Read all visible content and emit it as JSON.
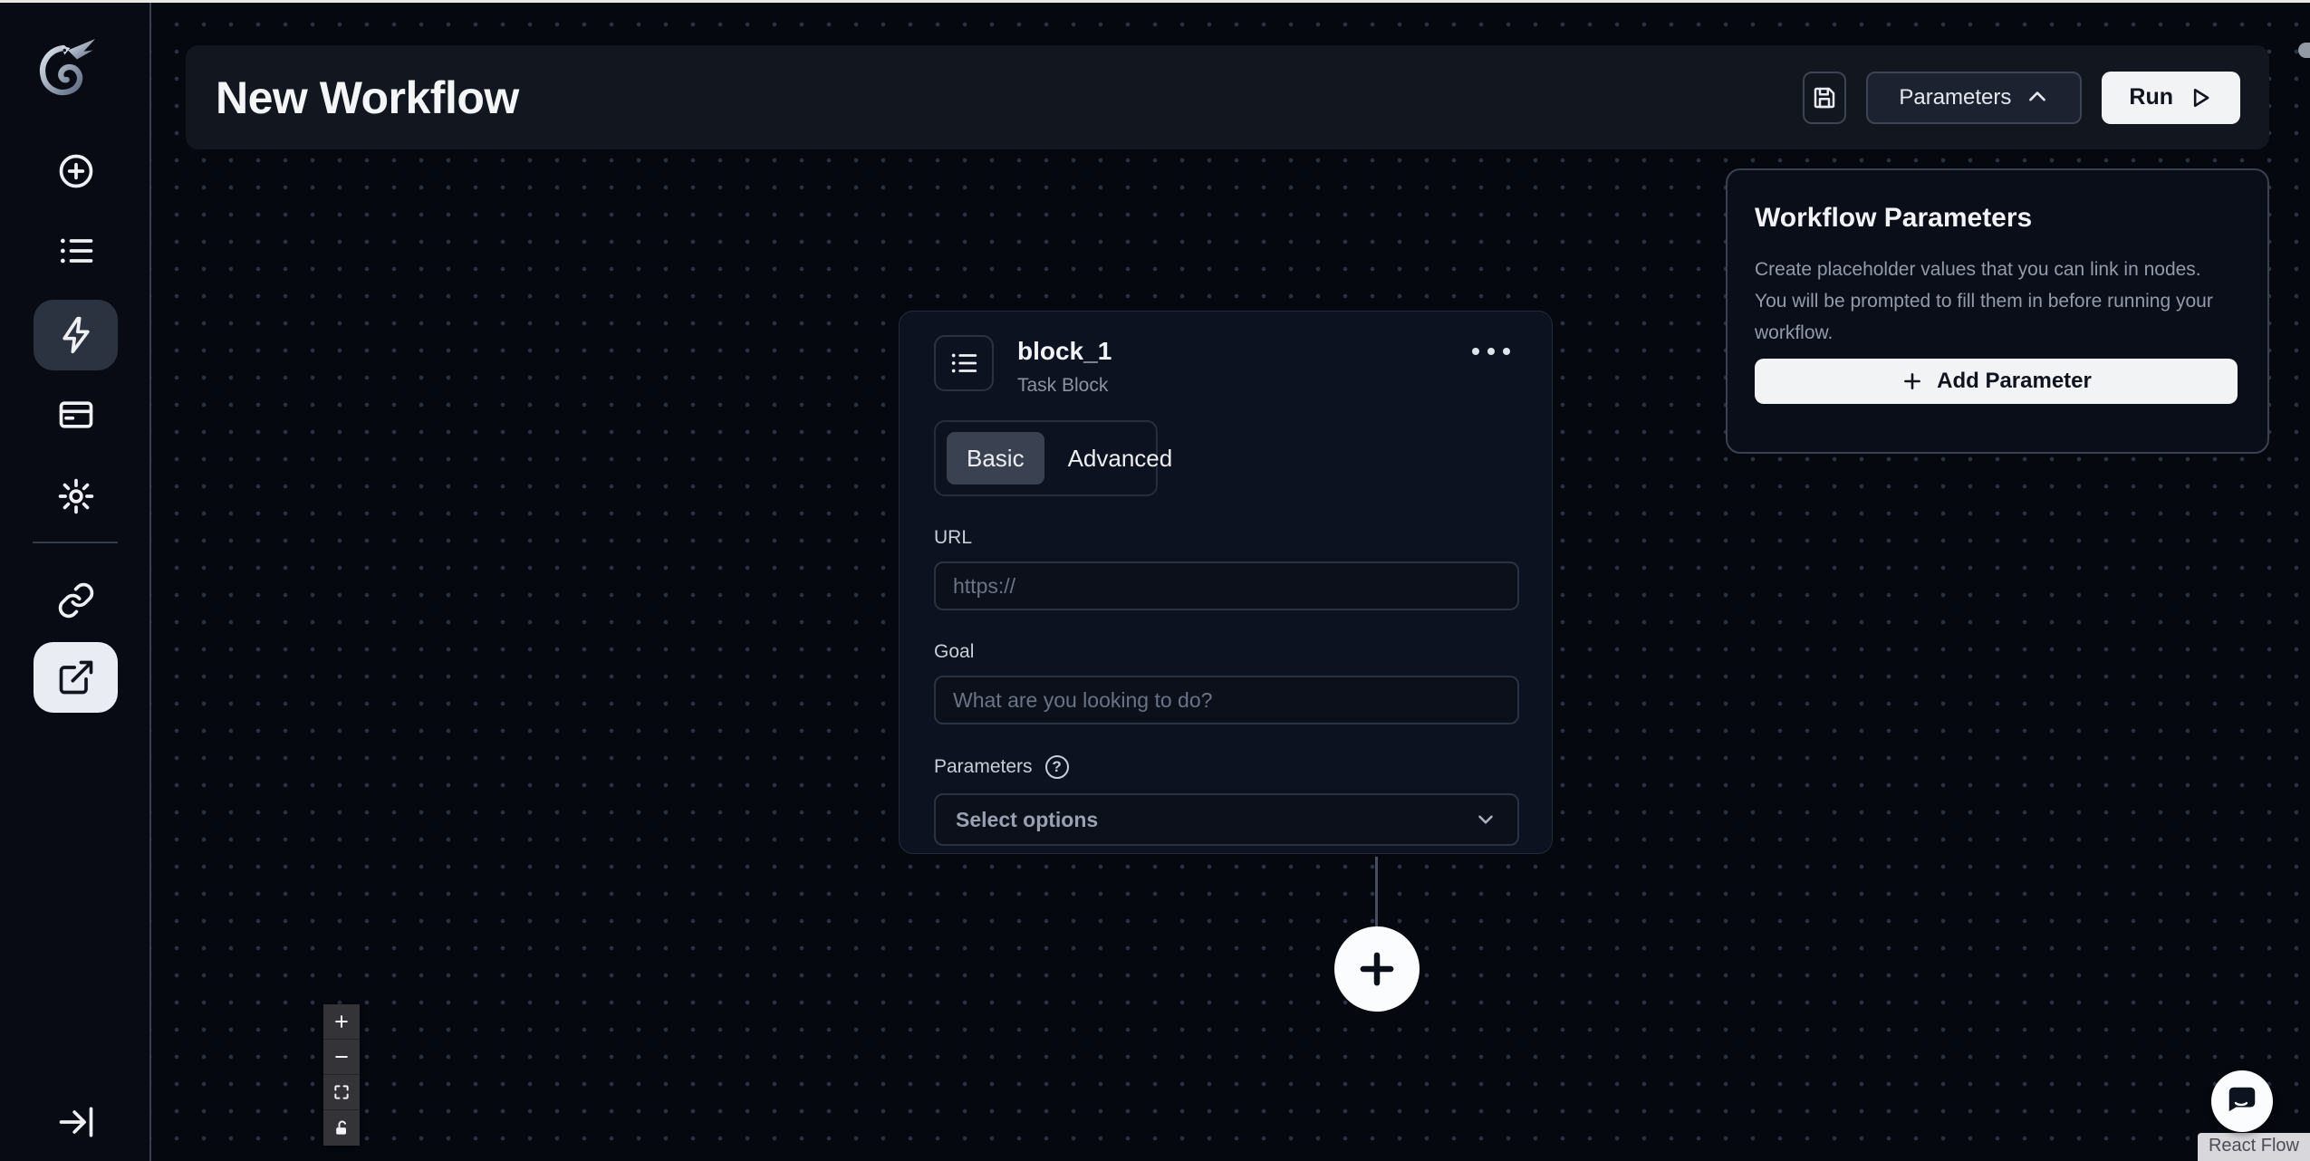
{
  "header": {
    "title": "New Workflow",
    "parameters_button": "Parameters",
    "run_button": "Run"
  },
  "sidebar": {
    "icons": [
      "dragon-logo",
      "plus-circle",
      "list",
      "zap",
      "credit-card",
      "gear",
      "link",
      "external-link",
      "arrow-right-to-line"
    ],
    "active_icon": "external-link"
  },
  "workflow_parameters_panel": {
    "title": "Workflow Parameters",
    "description_lines": [
      "Create placeholder values that you can link in nodes.",
      "You will be prompted to fill them in before running your",
      "workflow."
    ],
    "add_button": "Add Parameter"
  },
  "task_block": {
    "name": "block_1",
    "type_label": "Task Block",
    "tabs": [
      "Basic",
      "Advanced"
    ],
    "active_tab": "Basic",
    "url_label": "URL",
    "url_placeholder": "https://",
    "goal_label": "Goal",
    "goal_placeholder": "What are you looking to do?",
    "parameters_label": "Parameters",
    "parameters_select_placeholder": "Select options"
  },
  "canvas": {
    "attribution": "React Flow"
  },
  "colors": {
    "canvas_bg": "#05080f",
    "sidebar_bg": "#080b14",
    "header_bg": "#12161f",
    "card_bg": "#0d1220",
    "border": "#2b3242",
    "active_tab_bg": "#3a4150",
    "light_button_bg": "#f2f3f5",
    "muted_text": "#8b93a3",
    "dot_grid": "#2a3245"
  }
}
